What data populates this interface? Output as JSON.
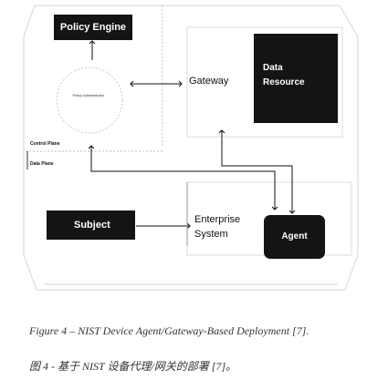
{
  "diagram": {
    "policy_engine": "Policy Engine",
    "policy_administrator": "Policy Administrator",
    "gateway": "Gateway",
    "data_resource_line1": "Data",
    "data_resource_line2": "Resource",
    "control_plane": "Control Plane",
    "data_plane": "Data Plane",
    "subject": "Subject",
    "enterprise_line1": "Enterprise",
    "enterprise_line2": "System",
    "agent": "Agent"
  },
  "caption": {
    "english": "Figure 4 – NIST Device Agent/Gateway-Based Deployment [7].",
    "chinese": "图 4 - 基于 NIST 设备代理/网关的部署 [7]。"
  }
}
